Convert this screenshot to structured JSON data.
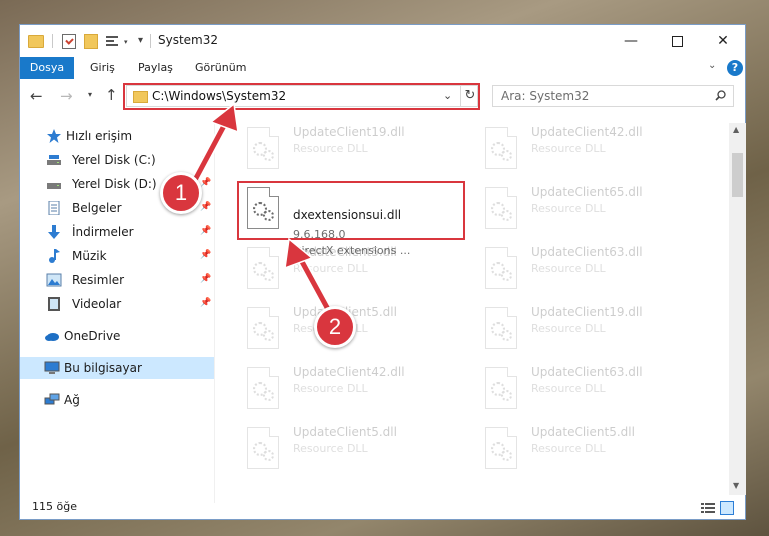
{
  "window": {
    "title": "System32",
    "controls": {
      "minimize": "—",
      "maximize": "",
      "close": "✕"
    }
  },
  "ribbon": {
    "tabs": [
      "Dosya",
      "Giriş",
      "Paylaş",
      "Görünüm"
    ],
    "help": "?"
  },
  "navigation": {
    "address": "C:\\Windows\\System32",
    "search_placeholder": "Ara: System32"
  },
  "sidebar": {
    "items": [
      {
        "label": "Hızlı erişim",
        "icon": "star-icon"
      },
      {
        "label": "Yerel Disk (C:)",
        "icon": "drive-icon",
        "pinned": true
      },
      {
        "label": "Yerel Disk (D:)",
        "icon": "drive-icon",
        "pinned": true
      },
      {
        "label": "Belgeler",
        "icon": "documents-icon",
        "pinned": true
      },
      {
        "label": "İndirmeler",
        "icon": "download-icon",
        "pinned": true
      },
      {
        "label": "Müzik",
        "icon": "music-icon",
        "pinned": true
      },
      {
        "label": "Resimler",
        "icon": "pictures-icon",
        "pinned": true
      },
      {
        "label": "Videolar",
        "icon": "videos-icon",
        "pinned": true
      },
      {
        "label": "OneDrive",
        "icon": "cloud-icon"
      },
      {
        "label": "Bu bilgisayar",
        "icon": "computer-icon",
        "selected": true
      },
      {
        "label": "Ağ",
        "icon": "network-icon"
      }
    ]
  },
  "files": [
    {
      "name": "UpdateClient19.dll",
      "type": "Resource DLL"
    },
    {
      "name": "UpdateClient42.dll",
      "type": "Resource DLL"
    },
    {
      "name": "dxextensionsui.dll",
      "version": "9.6.168.0",
      "type": "DirectX extensions ...",
      "highlighted": true
    },
    {
      "name": "UpdateClient65.dll",
      "type": "Resource DLL"
    },
    {
      "name": "UpdateClient5.dll",
      "type": "Resource DLL"
    },
    {
      "name": "UpdateClient63.dll",
      "type": "Resource DLL"
    },
    {
      "name": "UpdateClient5.dll",
      "type": "Resource DLL"
    },
    {
      "name": "UpdateClient19.dll",
      "type": "Resource DLL"
    },
    {
      "name": "UpdateClient42.dll",
      "type": "Resource DLL"
    },
    {
      "name": "UpdateClient63.dll",
      "type": "Resource DLL"
    },
    {
      "name": "UpdateClient5.dll",
      "type": "Resource DLL"
    },
    {
      "name": "UpdateClient5.dll",
      "type": "Resource DLL"
    }
  ],
  "status": {
    "item_count": "115 öğe"
  },
  "annotations": {
    "step1": "1",
    "step2": "2"
  },
  "colors": {
    "accent": "#1979ca",
    "highlight": "#d9363e",
    "selected": "#cce8ff"
  }
}
